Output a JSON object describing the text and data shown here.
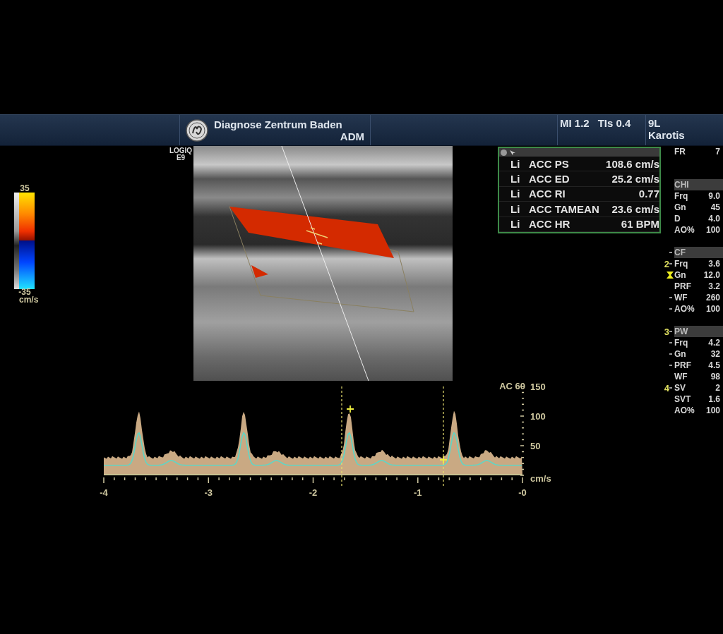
{
  "header": {
    "title": "Diagnose Zentrum Baden",
    "operator": "ADM",
    "indices": [
      "MI 1.2",
      "TIs 0.4"
    ],
    "probe": "9L",
    "preset": "Karotis"
  },
  "system_label": [
    "LOGIQ",
    "E9"
  ],
  "color_scale": {
    "max": "35",
    "min": "-35",
    "unit": "cm/s"
  },
  "measurements": [
    {
      "side": "Li",
      "name": "ACC PS",
      "value": "108.6 cm/s"
    },
    {
      "side": "Li",
      "name": "ACC ED",
      "value": "25.2 cm/s"
    },
    {
      "side": "Li",
      "name": "ACC RI",
      "value": "0.77"
    },
    {
      "side": "Li",
      "name": "ACC TAMEAN",
      "value": "23.6 cm/s"
    },
    {
      "side": "Li",
      "name": "ACC HR",
      "value": "61 BPM"
    }
  ],
  "parameters": {
    "top": [
      {
        "label": "FR",
        "value": "7"
      }
    ],
    "sections": [
      {
        "title": "CHI",
        "kind": "plain",
        "rows": [
          {
            "label": "Frq",
            "value": "9.0",
            "kind": "plain"
          },
          {
            "label": "Gn",
            "value": "45",
            "kind": "plain"
          },
          {
            "label": "D",
            "value": "4.0",
            "kind": "plain"
          },
          {
            "label": "AO%",
            "value": "100",
            "kind": "plain"
          }
        ]
      },
      {
        "title": "CF",
        "kind": "tick",
        "rows": [
          {
            "label": "Frq",
            "value": "3.6",
            "kind": "tick",
            "depth": "2"
          },
          {
            "label": "Gn",
            "value": "12.0",
            "kind": "focus"
          },
          {
            "label": "PRF",
            "value": "3.2",
            "kind": "plain"
          },
          {
            "label": "WF",
            "value": "260",
            "kind": "tick"
          },
          {
            "label": "AO%",
            "value": "100",
            "kind": "tick"
          }
        ]
      },
      {
        "title": "PW",
        "kind": "tick",
        "depth": "3",
        "rows": [
          {
            "label": "Frq",
            "value": "4.2",
            "kind": "tick"
          },
          {
            "label": "Gn",
            "value": "32",
            "kind": "tick"
          },
          {
            "label": "PRF",
            "value": "4.5",
            "kind": "tick"
          },
          {
            "label": "WF",
            "value": "98",
            "kind": "plain"
          },
          {
            "label": "SV",
            "value": "2",
            "kind": "tick",
            "depth": "4"
          },
          {
            "label": "SVT",
            "value": "1.6",
            "kind": "plain"
          },
          {
            "label": "AO%",
            "value": "100",
            "kind": "plain"
          }
        ]
      }
    ]
  },
  "spectrum": {
    "scale_label": "AC 60",
    "y_labels": [
      "150",
      "100",
      "50"
    ],
    "y_unit": "cm/s",
    "x_labels": [
      "-4",
      "-3",
      "-2",
      "-1",
      "-0"
    ]
  }
}
